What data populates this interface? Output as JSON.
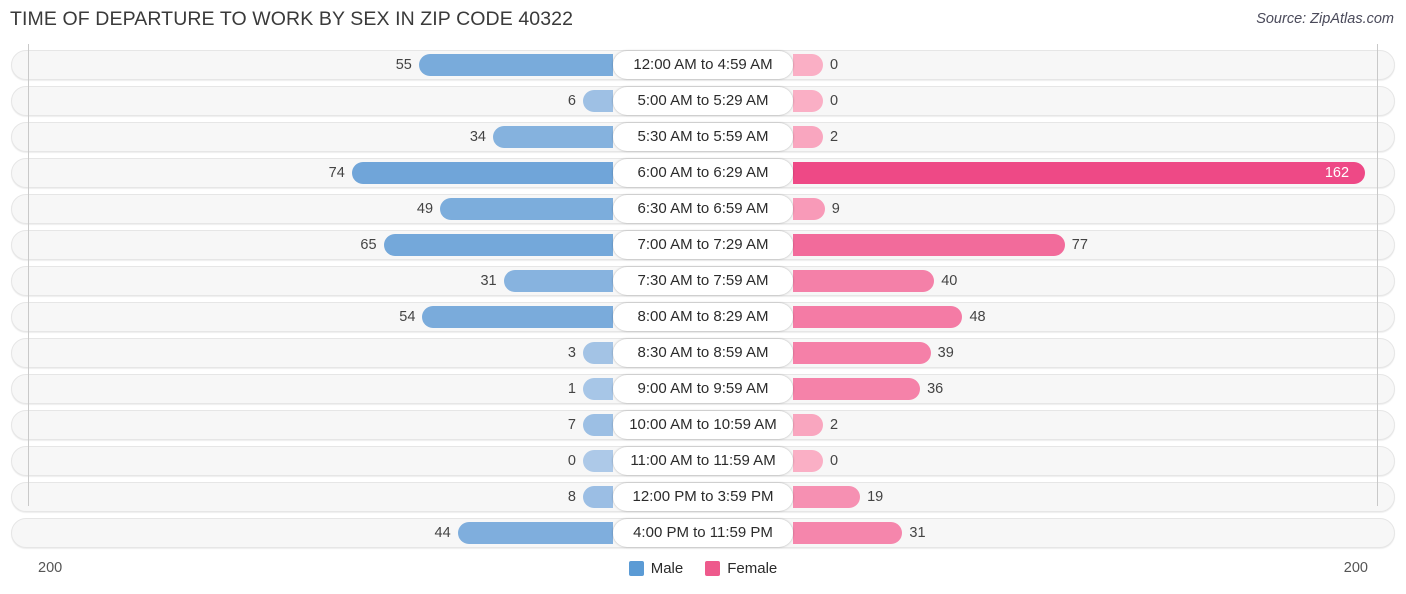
{
  "header": {
    "title": "TIME OF DEPARTURE TO WORK BY SEX IN ZIP CODE 40322",
    "source": "Source: ZipAtlas.com"
  },
  "legend": {
    "male_label": "Male",
    "female_label": "Female",
    "male_color": "#5B9BD5",
    "female_color": "#EE5A8C"
  },
  "axis": {
    "left_max_label": "200",
    "right_max_label": "200"
  },
  "chart_data": {
    "type": "bar",
    "title": "TIME OF DEPARTURE TO WORK BY SEX IN ZIP CODE 40322",
    "xlabel": "",
    "ylabel": "",
    "orientation": "horizontal-diverging",
    "axis_max": 200,
    "grid": false,
    "legend_position": "bottom-center",
    "categories": [
      "12:00 AM to 4:59 AM",
      "5:00 AM to 5:29 AM",
      "5:30 AM to 5:59 AM",
      "6:00 AM to 6:29 AM",
      "6:30 AM to 6:59 AM",
      "7:00 AM to 7:29 AM",
      "7:30 AM to 7:59 AM",
      "8:00 AM to 8:29 AM",
      "8:30 AM to 8:59 AM",
      "9:00 AM to 9:59 AM",
      "10:00 AM to 10:59 AM",
      "11:00 AM to 11:59 AM",
      "12:00 PM to 3:59 PM",
      "4:00 PM to 11:59 PM"
    ],
    "series": [
      {
        "name": "Male",
        "values": [
          55,
          6,
          34,
          74,
          49,
          65,
          31,
          54,
          3,
          1,
          7,
          0,
          8,
          44
        ]
      },
      {
        "name": "Female",
        "values": [
          0,
          0,
          2,
          162,
          9,
          77,
          40,
          48,
          39,
          36,
          2,
          0,
          19,
          31
        ]
      }
    ]
  },
  "rows": [
    {
      "label": "12:00 AM to 4:59 AM",
      "male": "55",
      "female": "0"
    },
    {
      "label": "5:00 AM to 5:29 AM",
      "male": "6",
      "female": "0"
    },
    {
      "label": "5:30 AM to 5:59 AM",
      "male": "34",
      "female": "2"
    },
    {
      "label": "6:00 AM to 6:29 AM",
      "male": "74",
      "female": "162"
    },
    {
      "label": "6:30 AM to 6:59 AM",
      "male": "49",
      "female": "9"
    },
    {
      "label": "7:00 AM to 7:29 AM",
      "male": "65",
      "female": "77"
    },
    {
      "label": "7:30 AM to 7:59 AM",
      "male": "31",
      "female": "40"
    },
    {
      "label": "8:00 AM to 8:29 AM",
      "male": "54",
      "female": "48"
    },
    {
      "label": "8:30 AM to 8:59 AM",
      "male": "3",
      "female": "39"
    },
    {
      "label": "9:00 AM to 9:59 AM",
      "male": "1",
      "female": "36"
    },
    {
      "label": "10:00 AM to 10:59 AM",
      "male": "7",
      "female": "2"
    },
    {
      "label": "11:00 AM to 11:59 AM",
      "male": "0",
      "female": "0"
    },
    {
      "label": "12:00 PM to 3:59 PM",
      "male": "8",
      "female": "19"
    },
    {
      "label": "4:00 PM to 11:59 PM",
      "male": "44",
      "female": "31"
    }
  ]
}
